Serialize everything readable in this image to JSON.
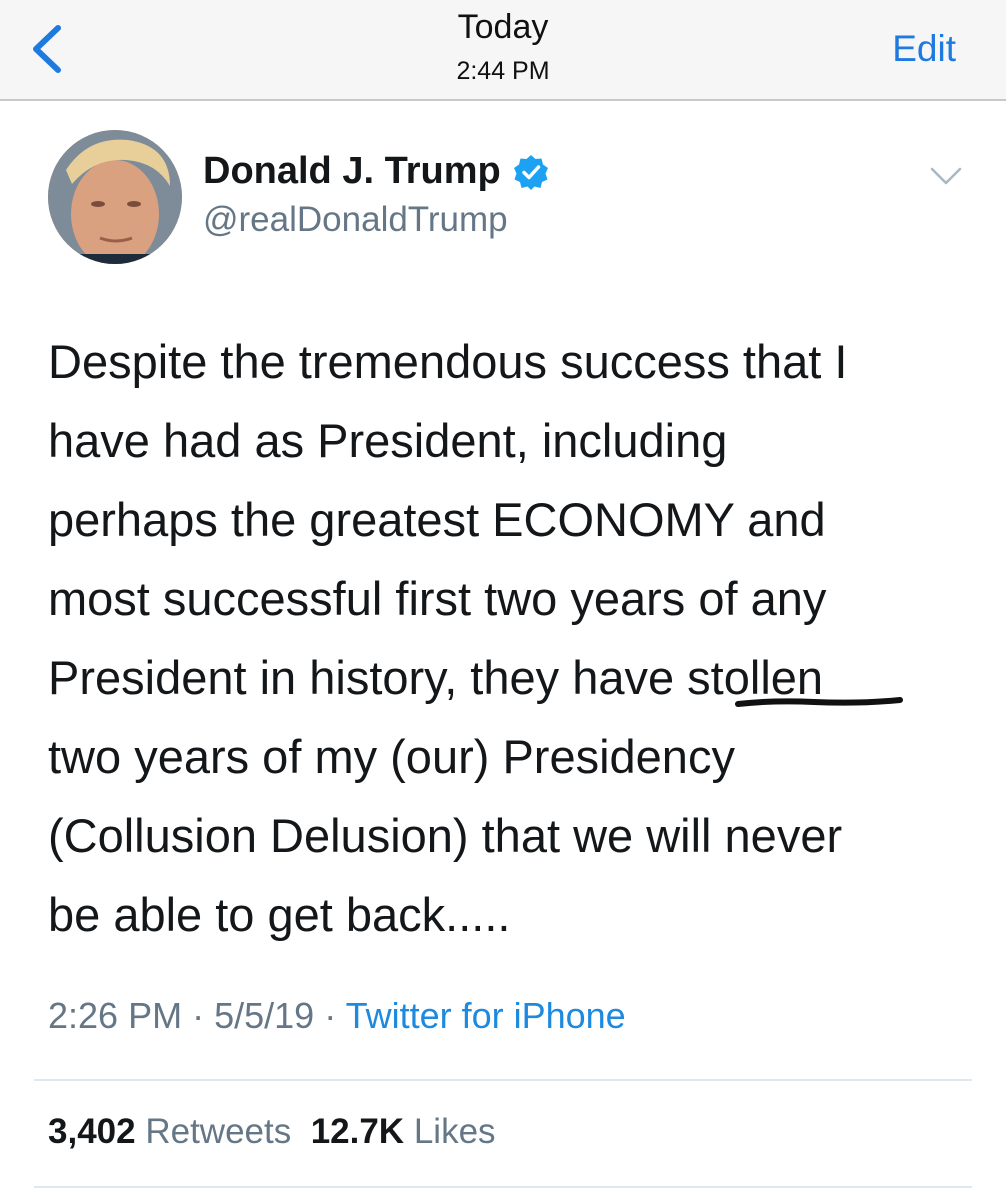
{
  "nav": {
    "title": "Today",
    "time": "2:44 PM",
    "edit_label": "Edit"
  },
  "tweet": {
    "author": {
      "name": "Donald J. Trump",
      "handle": "@realDonaldTrump",
      "verified": true
    },
    "text_lines": [
      "Despite the tremendous success that I",
      "have had as President, including",
      "perhaps the greatest ECONOMY and",
      "most successful first two years of any",
      "President in history, they have stollen",
      "two years of my (our) Presidency",
      "(Collusion Delusion) that we will never",
      "be able to get back....."
    ],
    "time": "2:26 PM",
    "date": "5/5/19",
    "separator": "·",
    "source": "Twitter for iPhone",
    "stats": {
      "retweets_count": "3,402",
      "retweets_label": "Retweets",
      "likes_count": "12.7K",
      "likes_label": "Likes"
    }
  },
  "icons": {
    "back": "chevron-left-icon",
    "verified": "verified-badge-icon",
    "more": "chevron-down-icon"
  },
  "colors": {
    "accent": "#1f7ae0",
    "link": "#1d8ae0",
    "secondary_text": "#657786",
    "verified_badge": "#1da1f2"
  }
}
